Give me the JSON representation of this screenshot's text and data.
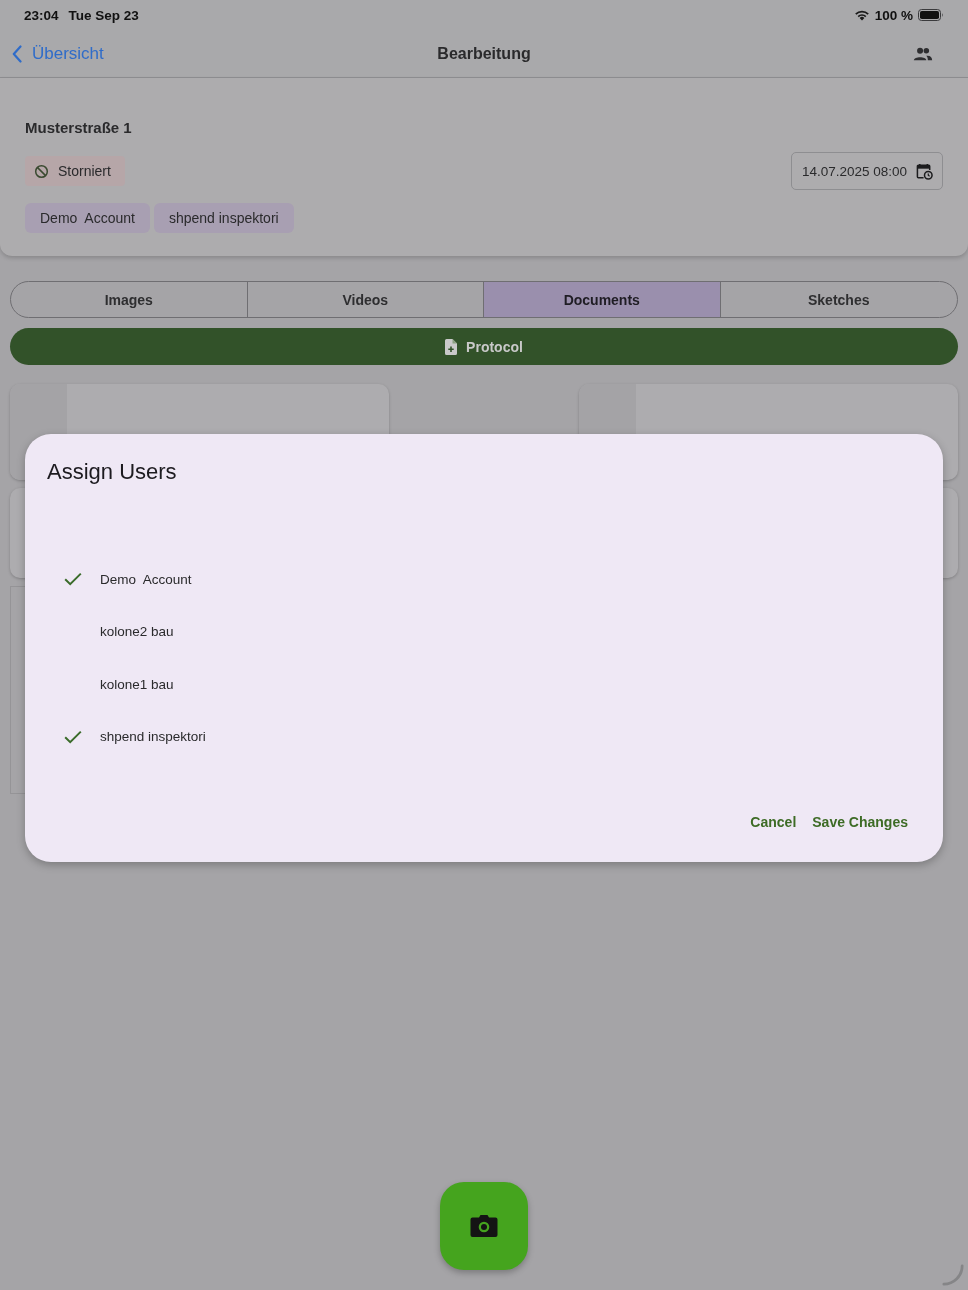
{
  "status_bar": {
    "time": "23:04",
    "date": "Tue Sep 23",
    "battery": "100 %"
  },
  "nav_bar": {
    "back_label": "Übersicht",
    "title": "Bearbeitung"
  },
  "header_card": {
    "title": "Musterstraße 1",
    "status": {
      "label": "Storniert"
    },
    "date_field": {
      "value": "14.07.2025 08:00"
    },
    "assigned_users": [
      "Demo  Account",
      "shpend inspektori"
    ]
  },
  "tabs": [
    {
      "label": "Images",
      "selected": false
    },
    {
      "label": "Videos",
      "selected": false
    },
    {
      "label": "Documents",
      "selected": true
    },
    {
      "label": "Sketches",
      "selected": false
    }
  ],
  "protocol_button": {
    "label": "Protocol"
  },
  "dialog": {
    "title": "Assign Users",
    "users": [
      {
        "name": "Demo  Account",
        "checked": true
      },
      {
        "name": "kolone2 bau",
        "checked": false
      },
      {
        "name": "kolone1 bau",
        "checked": false
      },
      {
        "name": "shpend inspektori",
        "checked": true
      }
    ],
    "buttons": [
      "Cancel",
      "Save Changes"
    ]
  }
}
